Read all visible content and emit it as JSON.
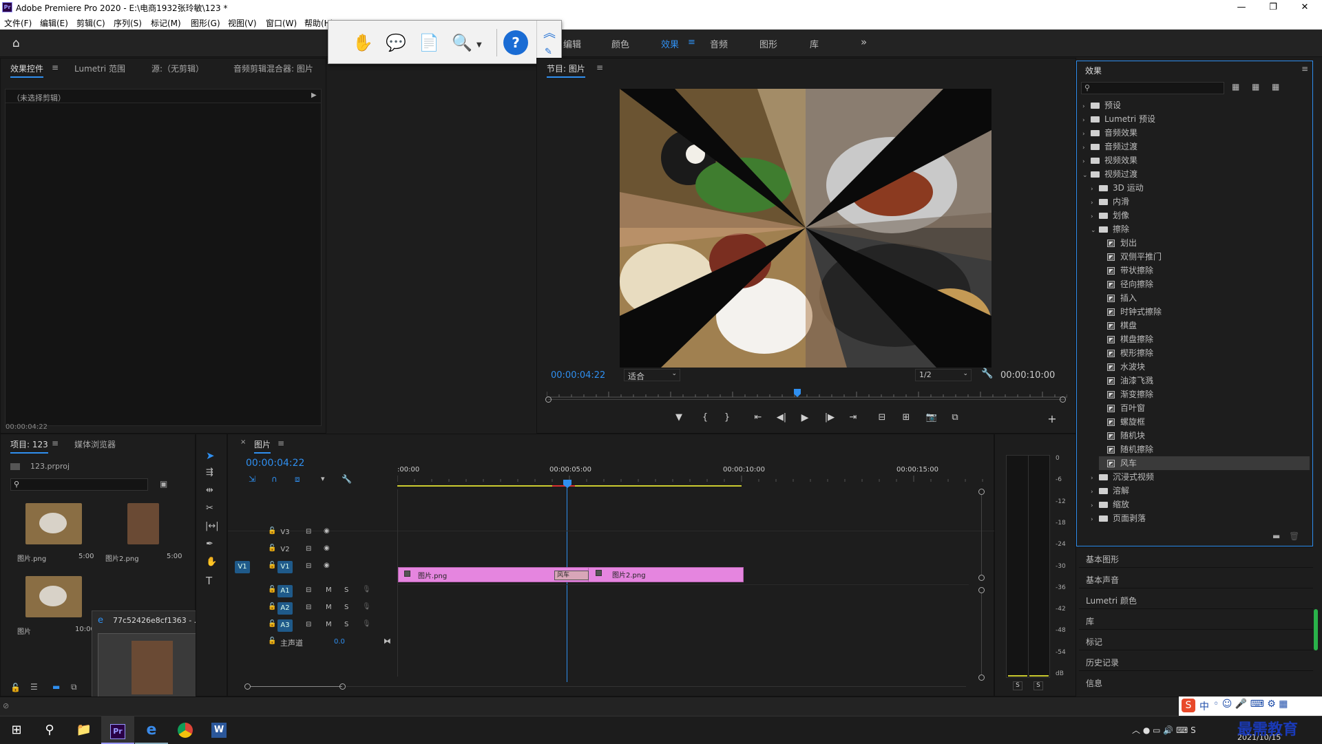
{
  "window": {
    "app_icon": "Pr",
    "title": "Adobe Premiere Pro 2020 - E:\\电商1932张玲敏\\123 *",
    "minimize": "—",
    "maximize": "❐",
    "close": "✕"
  },
  "menu": [
    "文件(F)",
    "编辑(E)",
    "剪辑(C)",
    "序列(S)",
    "标记(M)",
    "图形(G)",
    "视图(V)",
    "窗口(W)",
    "帮助(H)"
  ],
  "workspaces": {
    "items": [
      "编辑",
      "颜色",
      "效果",
      "音频",
      "图形",
      "库"
    ],
    "active": "效果",
    "more": "»",
    "menu_icon": "≡"
  },
  "help_toolbar": {
    "icons": [
      "hand-icon",
      "comment-icon",
      "document-arrow-icon",
      "zoom-doc-icon",
      "help-icon"
    ],
    "up": "︽"
  },
  "effect_controls": {
    "tabs": [
      "效果控件",
      "Lumetri 范围",
      "源:（无剪辑）",
      "音频剪辑混合器: 图片"
    ],
    "no_clip": "（未选择剪辑）",
    "timecode": "00:00:04:22"
  },
  "program": {
    "title": "节目: 图片",
    "timecode": "00:00:04:22",
    "fit": "适合",
    "resolution": "1/2",
    "duration": "00:00:10:00"
  },
  "transport": [
    "▼",
    "{",
    "}",
    "⇤",
    "◀|",
    "▶",
    "|▶",
    "⇥",
    "⊟",
    "⊞",
    "📷",
    "⧉",
    "+"
  ],
  "effects_panel": {
    "title": "效果",
    "search_placeholder": "",
    "tree": [
      {
        "label": "预设",
        "level": 0,
        "type": "folder",
        "open": false
      },
      {
        "label": "Lumetri 预设",
        "level": 0,
        "type": "folder",
        "open": false
      },
      {
        "label": "音频效果",
        "level": 0,
        "type": "folder",
        "open": false
      },
      {
        "label": "音频过渡",
        "level": 0,
        "type": "folder",
        "open": false
      },
      {
        "label": "视频效果",
        "level": 0,
        "type": "folder",
        "open": false
      },
      {
        "label": "视频过渡",
        "level": 0,
        "type": "folder",
        "open": true
      },
      {
        "label": "3D 运动",
        "level": 1,
        "type": "folder",
        "open": false
      },
      {
        "label": "内滑",
        "level": 1,
        "type": "folder",
        "open": false
      },
      {
        "label": "划像",
        "level": 1,
        "type": "folder",
        "open": false
      },
      {
        "label": "擦除",
        "level": 1,
        "type": "folder",
        "open": true
      },
      {
        "label": "划出",
        "level": 2,
        "type": "fx"
      },
      {
        "label": "双侧平推门",
        "level": 2,
        "type": "fx"
      },
      {
        "label": "带状擦除",
        "level": 2,
        "type": "fx"
      },
      {
        "label": "径向擦除",
        "level": 2,
        "type": "fx"
      },
      {
        "label": "插入",
        "level": 2,
        "type": "fx"
      },
      {
        "label": "时钟式擦除",
        "level": 2,
        "type": "fx"
      },
      {
        "label": "棋盘",
        "level": 2,
        "type": "fx"
      },
      {
        "label": "棋盘擦除",
        "level": 2,
        "type": "fx"
      },
      {
        "label": "楔形擦除",
        "level": 2,
        "type": "fx"
      },
      {
        "label": "水波块",
        "level": 2,
        "type": "fx"
      },
      {
        "label": "油漆飞溅",
        "level": 2,
        "type": "fx"
      },
      {
        "label": "渐变擦除",
        "level": 2,
        "type": "fx"
      },
      {
        "label": "百叶窗",
        "level": 2,
        "type": "fx"
      },
      {
        "label": "螺旋框",
        "level": 2,
        "type": "fx"
      },
      {
        "label": "随机块",
        "level": 2,
        "type": "fx"
      },
      {
        "label": "随机擦除",
        "level": 2,
        "type": "fx"
      },
      {
        "label": "风车",
        "level": 2,
        "type": "fx",
        "selected": true
      },
      {
        "label": "沉浸式视频",
        "level": 1,
        "type": "folder",
        "open": false
      },
      {
        "label": "溶解",
        "level": 1,
        "type": "folder",
        "open": false
      },
      {
        "label": "缩放",
        "level": 1,
        "type": "folder",
        "open": false
      },
      {
        "label": "页面剥落",
        "level": 1,
        "type": "folder",
        "open": false
      }
    ]
  },
  "side_panels": [
    "基本图形",
    "基本声音",
    "Lumetri 颜色",
    "库",
    "标记",
    "历史记录",
    "信息"
  ],
  "project": {
    "tabs": [
      "项目: 123",
      "媒体浏览器"
    ],
    "file": "123.prproj",
    "items": [
      {
        "name": "图片.png",
        "dur": "5:00"
      },
      {
        "name": "图片2.png",
        "dur": "5:00"
      },
      {
        "name": "图片",
        "dur": "10:00"
      }
    ]
  },
  "timeline": {
    "tab": "图片",
    "timecode": "00:00:04:22",
    "ruler": [
      ":00:00",
      "00:00:05:00",
      "00:00:10:00",
      "00:00:15:00"
    ],
    "tracks": [
      "V3",
      "V2",
      "V1",
      "A1",
      "A2",
      "A3"
    ],
    "master": "主声道",
    "master_val": "0.0",
    "M": "M",
    "S": "S",
    "clips": [
      {
        "name": "图片.png"
      },
      {
        "name": "图片2.png"
      }
    ],
    "transition": "风车"
  },
  "meter": {
    "scale": [
      "0",
      "-6",
      "-12",
      "-18",
      "-24",
      "-30",
      "-36",
      "-42",
      "-48",
      "-54",
      "dB"
    ],
    "solo": [
      "S",
      "S"
    ]
  },
  "thumbnail": {
    "title": "77c52426e8cf1363 - ..."
  },
  "tray": {
    "ime": "中",
    "date": "2021/10/15",
    "watermark": "最需教育"
  }
}
